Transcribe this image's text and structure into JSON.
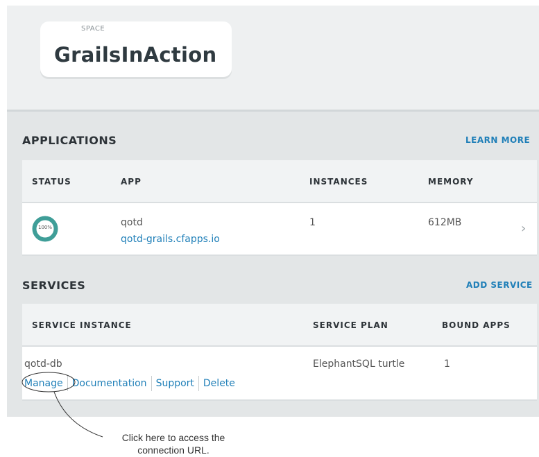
{
  "space": {
    "label": "SPACE",
    "name": "GrailsInAction"
  },
  "applications": {
    "title": "APPLICATIONS",
    "link": "LEARN MORE",
    "headers": [
      "STATUS",
      "APP",
      "INSTANCES",
      "MEMORY"
    ],
    "rows": [
      {
        "status": "100%",
        "name": "qotd",
        "url": "qotd-grails.cfapps.io",
        "instances": "1",
        "memory": "612MB"
      }
    ]
  },
  "services": {
    "title": "SERVICES",
    "link": "ADD SERVICE",
    "headers": [
      "SERVICE INSTANCE",
      "SERVICE PLAN",
      "BOUND APPS"
    ],
    "rows": [
      {
        "name": "qotd-db",
        "plan": "ElephantSQL turtle",
        "bound": "1",
        "actions": [
          "Manage",
          "Documentation",
          "Support",
          "Delete"
        ]
      }
    ]
  },
  "annotation": {
    "line1": "Click here to access the",
    "line2": "connection URL."
  },
  "colors": {
    "accent": "#1f7fb8",
    "donut": "#3f9e98"
  }
}
